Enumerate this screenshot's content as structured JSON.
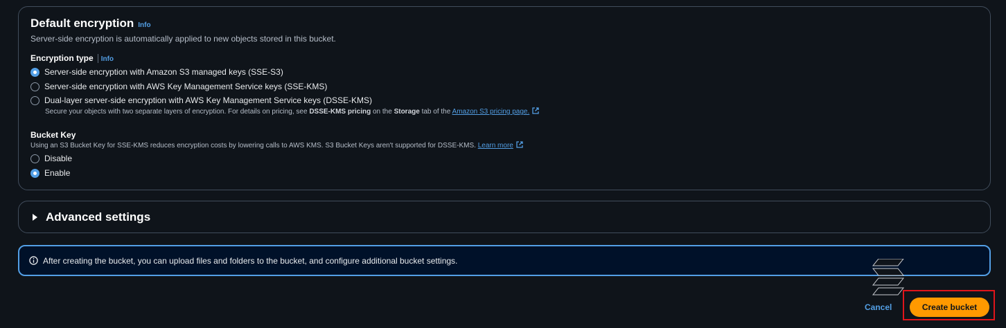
{
  "encryption": {
    "title": "Default encryption",
    "info": "Info",
    "description": "Server-side encryption is automatically applied to new objects stored in this bucket.",
    "type_label": "Encryption type",
    "type_info": "Info",
    "options": [
      {
        "label": "Server-side encryption with Amazon S3 managed keys (SSE-S3)",
        "selected": true
      },
      {
        "label": "Server-side encryption with AWS Key Management Service keys (SSE-KMS)",
        "selected": false
      },
      {
        "label": "Dual-layer server-side encryption with AWS Key Management Service keys (DSSE-KMS)",
        "selected": false
      }
    ],
    "dsse_desc_prefix": "Secure your objects with two separate layers of encryption. For details on pricing, see ",
    "dsse_desc_bold1": "DSSE-KMS pricing",
    "dsse_desc_mid": " on the ",
    "dsse_desc_bold2": "Storage",
    "dsse_desc_suffix": " tab of the ",
    "dsse_link": "Amazon S3 pricing page."
  },
  "bucket_key": {
    "label": "Bucket Key",
    "description": "Using an S3 Bucket Key for SSE-KMS reduces encryption costs by lowering calls to AWS KMS. S3 Bucket Keys aren't supported for DSSE-KMS. ",
    "learn_more": "Learn more",
    "options": [
      {
        "label": "Disable",
        "selected": false
      },
      {
        "label": "Enable",
        "selected": true
      }
    ]
  },
  "advanced": {
    "label": "Advanced settings"
  },
  "alert": {
    "text": "After creating the bucket, you can upload files and folders to the bucket, and configure additional bucket settings."
  },
  "actions": {
    "cancel": "Cancel",
    "create": "Create bucket"
  },
  "colors": {
    "accent": "#539fe5",
    "primary_button": "#ff9900",
    "highlight": "#e0151b"
  }
}
